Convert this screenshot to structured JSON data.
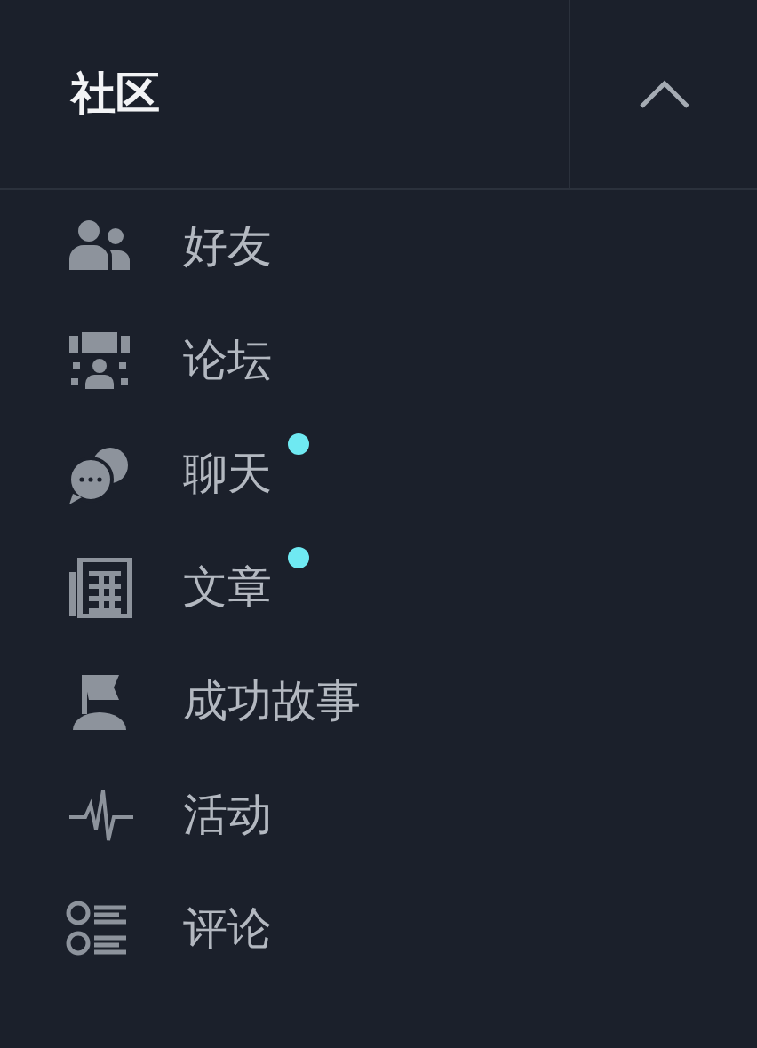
{
  "header": {
    "title": "社区",
    "expanded": true
  },
  "items": [
    {
      "kind": "friends",
      "label": "好友",
      "unread": false
    },
    {
      "kind": "forum",
      "label": "论坛",
      "unread": false
    },
    {
      "kind": "chat",
      "label": "聊天",
      "unread": true
    },
    {
      "kind": "article",
      "label": "文章",
      "unread": true
    },
    {
      "kind": "story",
      "label": "成功故事",
      "unread": false
    },
    {
      "kind": "activity",
      "label": "活动",
      "unread": false
    },
    {
      "kind": "review",
      "label": "评论",
      "unread": false
    }
  ]
}
